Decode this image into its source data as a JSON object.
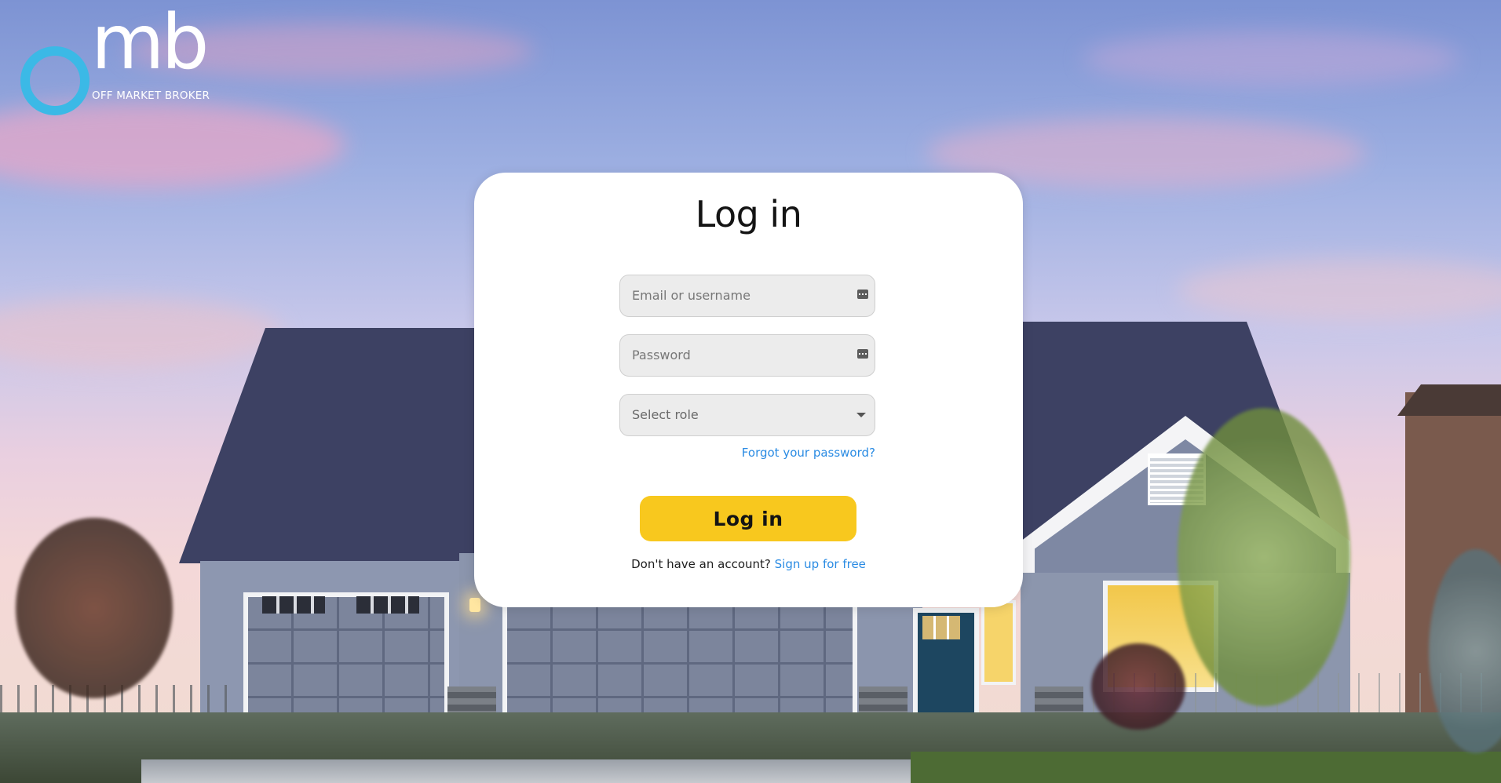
{
  "brand": {
    "logo_text": "mb",
    "logo_subtitle": "OFF MARKET BROKER",
    "accent_color": "#3bb9e6"
  },
  "login": {
    "title": "Log in",
    "email_placeholder": "Email or username",
    "password_placeholder": "Password",
    "role_select": {
      "selected": "Select role"
    },
    "forgot_password": "Forgot your password?",
    "submit_label": "Log in",
    "signup_prompt": "Don't have an account?",
    "signup_link": "Sign up for free",
    "button_color": "#f8c81e",
    "link_color": "#2a8be3"
  },
  "icons": {
    "email_field_icon": "password-manager-icon",
    "password_field_icon": "password-manager-icon",
    "role_dropdown_icon": "chevron-down-icon"
  }
}
